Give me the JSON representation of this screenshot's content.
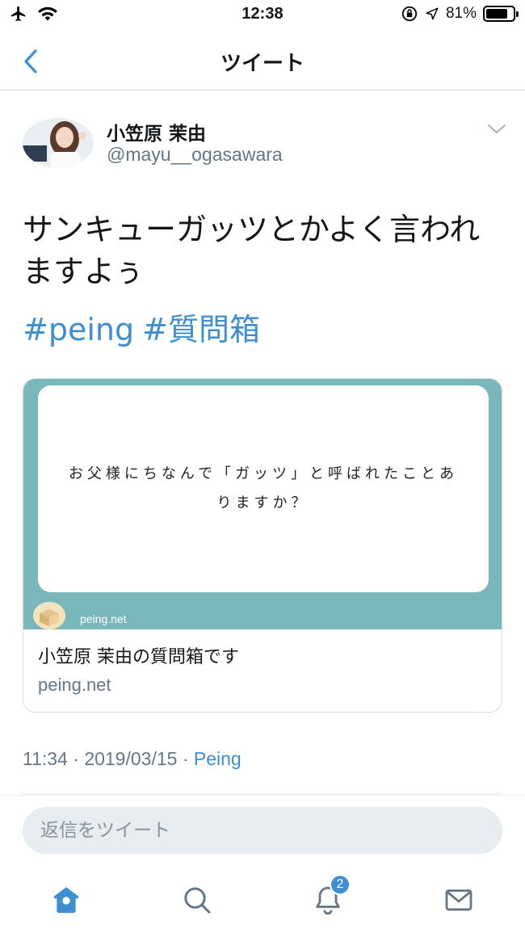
{
  "status_bar": {
    "time": "12:38",
    "battery": "81%",
    "battery_level": 0.81
  },
  "nav": {
    "title": "ツイート"
  },
  "tweet": {
    "author_name": "小笠原 茉由",
    "author_handle": "@mayu__ogasawara",
    "text_line1": "サンキューガッツとかよく言われ",
    "text_line2": "ますよぅ",
    "hashtags": [
      "#peing",
      "#質問箱"
    ],
    "card": {
      "question_line1": "お父様にちなんで「ガッツ」と呼ばれたことあ",
      "question_line2": "りますか？",
      "site_label": "peing.net",
      "title": "小笠原 茉由の質問箱です",
      "domain": "peing.net"
    },
    "meta": {
      "time": "11:34",
      "separator": " · ",
      "date": "2019/03/15",
      "source": "Peing"
    }
  },
  "reply": {
    "placeholder": "返信をツイート"
  },
  "tabs": {
    "notifications_badge": "2",
    "icons": [
      "home-icon",
      "search-icon",
      "bell-icon",
      "mail-icon"
    ]
  },
  "colors": {
    "accent": "#3d8fd1",
    "card_bg": "#7ab7ba",
    "muted": "#657786"
  }
}
